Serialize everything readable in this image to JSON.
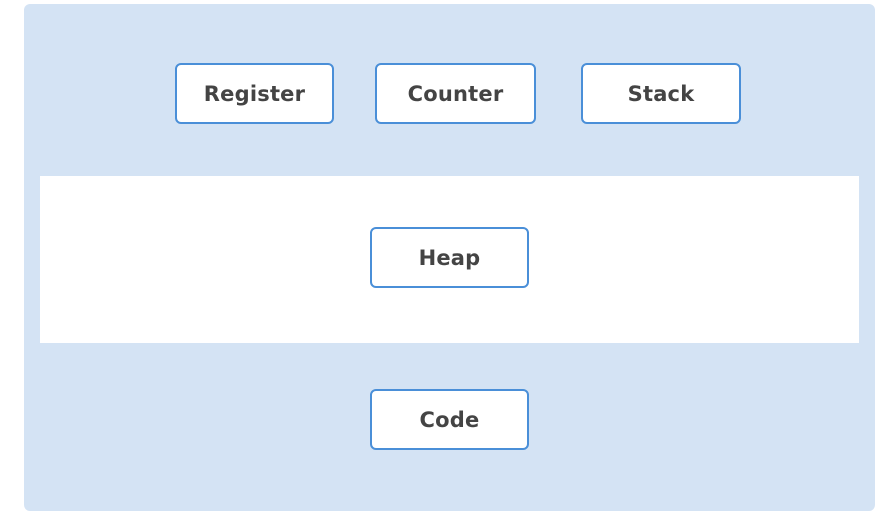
{
  "diagram": {
    "top_row": [
      {
        "label": "Register"
      },
      {
        "label": "Counter"
      },
      {
        "label": "Stack"
      }
    ],
    "heap": {
      "label": "Heap"
    },
    "code": {
      "label": "Code"
    }
  },
  "colors": {
    "panel_background": "#d4e3f4",
    "heap_band_background": "#ffffff",
    "node_border": "#4a8fd8",
    "node_text": "#444444"
  }
}
